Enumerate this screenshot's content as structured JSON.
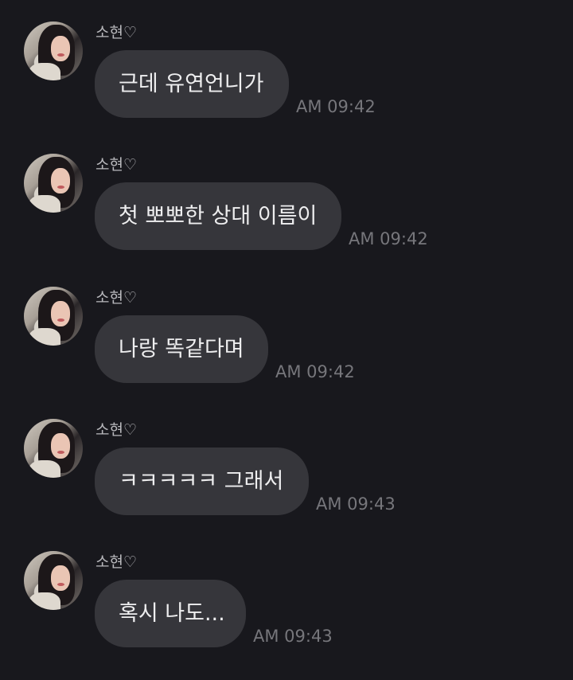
{
  "chat": {
    "sender": "소현♡",
    "messages": [
      {
        "text": "근데 유연언니가",
        "time": "AM 09:42"
      },
      {
        "text": "첫 뽀뽀한 상대 이름이",
        "time": "AM 09:42"
      },
      {
        "text": "나랑 똑같다며",
        "time": "AM 09:42"
      },
      {
        "text": "ㅋㅋㅋㅋㅋ 그래서",
        "time": "AM 09:43"
      },
      {
        "text": "혹시 나도...",
        "time": "AM 09:43"
      }
    ]
  }
}
